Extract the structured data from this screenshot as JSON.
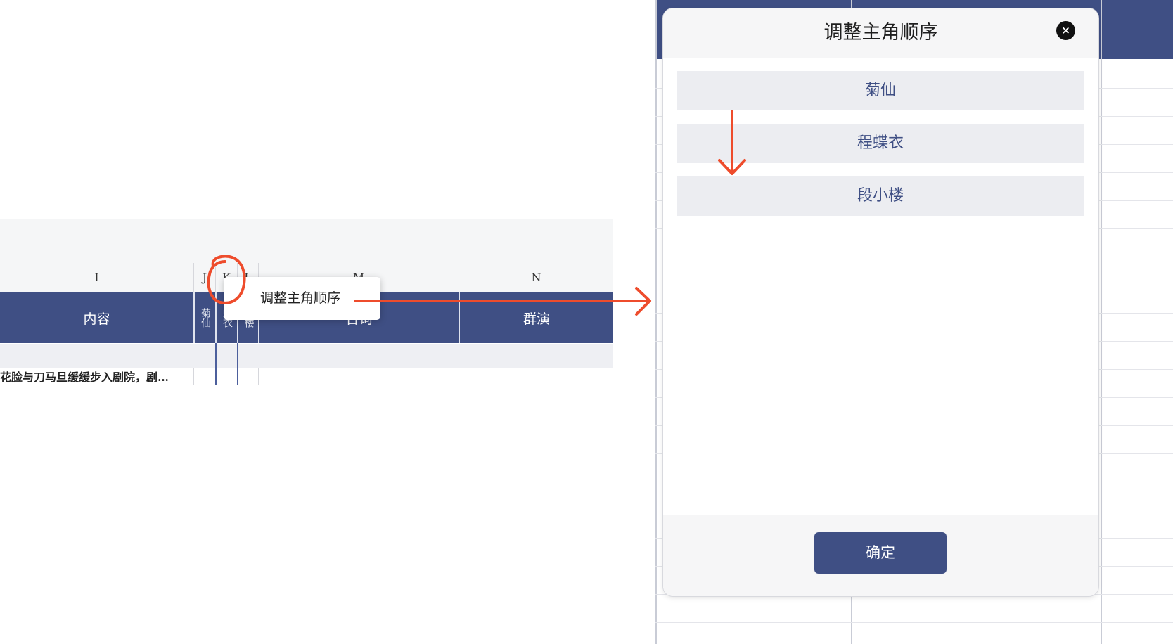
{
  "sheet": {
    "column_letters": {
      "i": "I",
      "j": "J",
      "k": "K",
      "l": "L",
      "m": "M",
      "n": "N"
    },
    "headers": {
      "content": "内容",
      "role_1": "菊仙",
      "role_2": "蝶衣",
      "role_3": "小楼",
      "col_m": "台词",
      "crowd": "群演"
    },
    "row_1_content": "花脸与刀马旦缓缓步入剧院，剧…"
  },
  "context_menu": {
    "item": "调整主角顺序"
  },
  "dialog": {
    "title": "调整主角顺序",
    "close_icon": "×",
    "items": [
      "菊仙",
      "程蝶衣",
      "段小楼"
    ],
    "confirm": "确定"
  },
  "colors": {
    "header_blue": "#3f4f84",
    "annotation_red": "#ee4c2c"
  }
}
